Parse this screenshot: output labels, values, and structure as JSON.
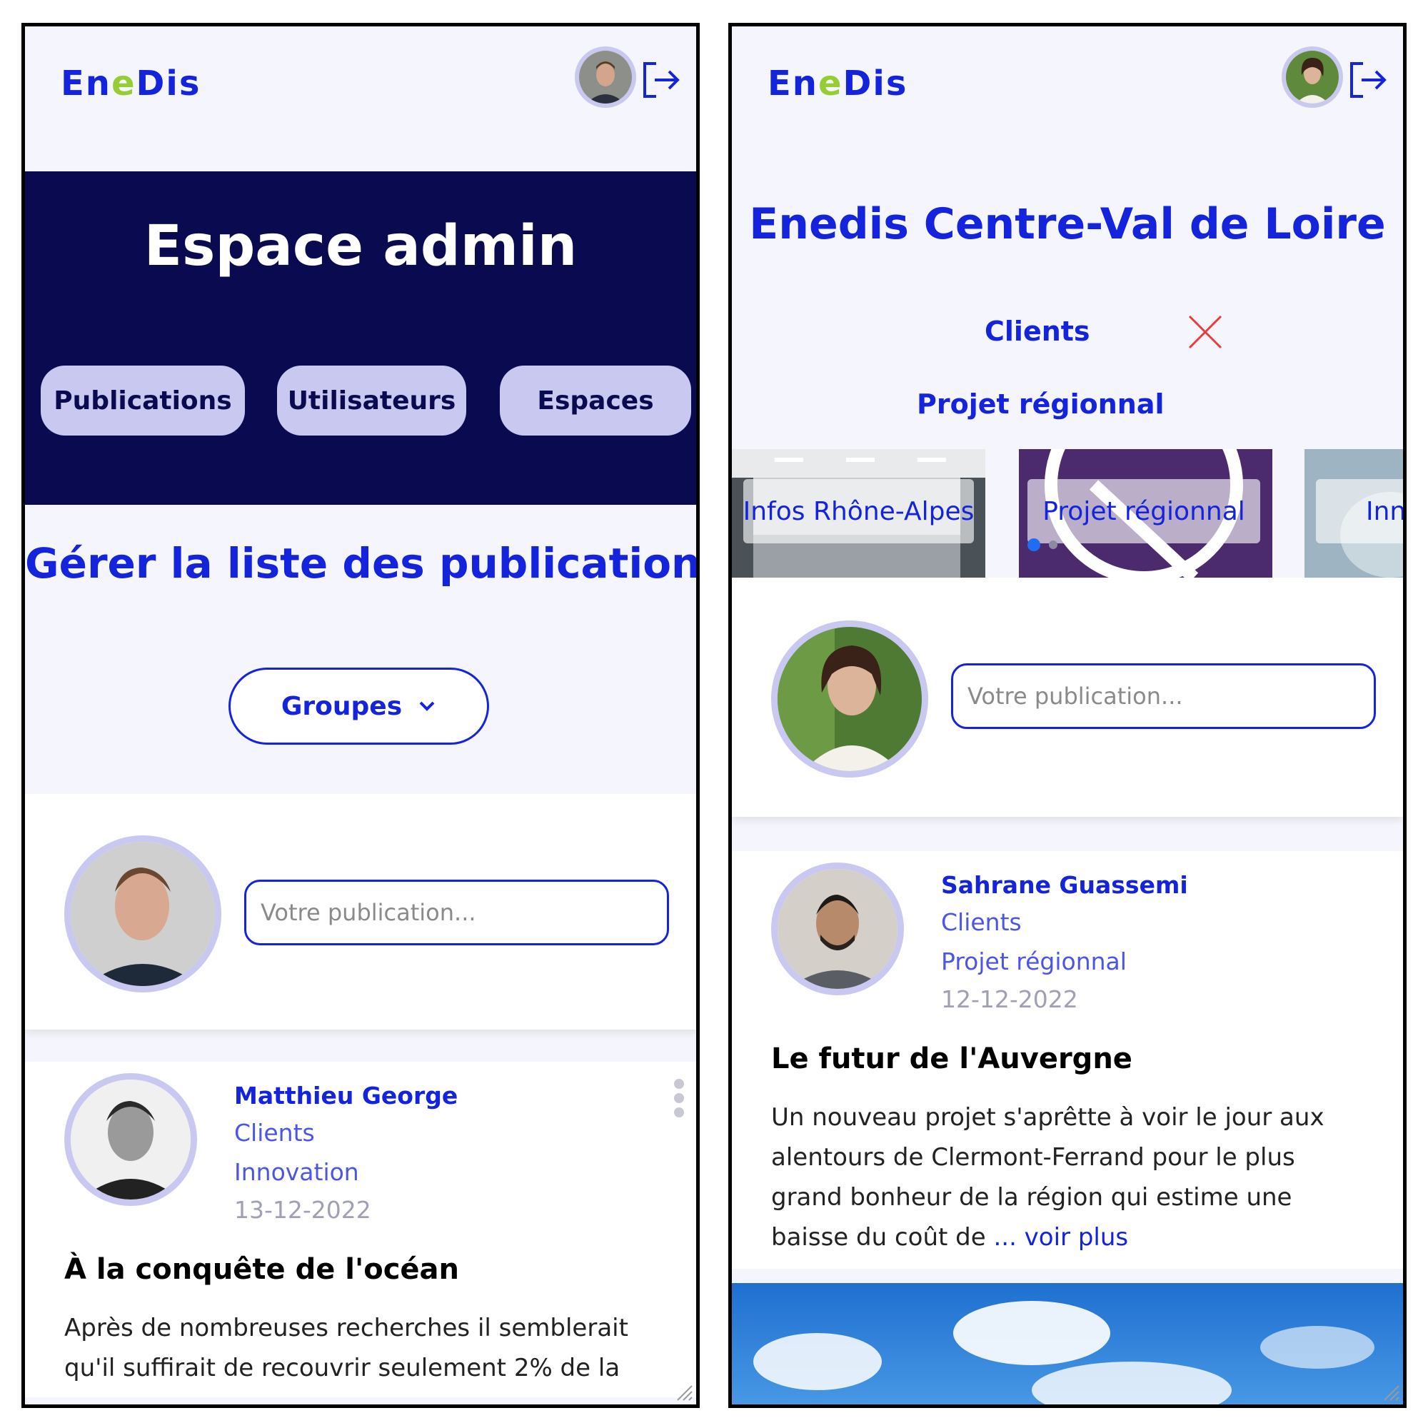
{
  "colors": {
    "brand_blue": "#1423dc",
    "navy": "#0a0a50",
    "lavender": "#c8c8f0",
    "green": "#96cd32",
    "close_red": "#e83c3c"
  },
  "left": {
    "header": {
      "logo_parts": [
        "En",
        "e",
        "Dis"
      ],
      "logout_icon": "logout-icon"
    },
    "banner": {
      "title": "Espace admin",
      "buttons": {
        "publications": "Publications",
        "users": "Utilisateurs",
        "spaces": "Espaces"
      }
    },
    "section_title": "Gérer la liste des publications",
    "group_select": {
      "label": "Groupes",
      "icon": "chevron-down-icon"
    },
    "composer": {
      "placeholder": "Votre publication..."
    },
    "post": {
      "author": "Matthieu  George",
      "category": "Clients",
      "group": "Innovation",
      "date": "13-12-2022",
      "title": "À la conquête de l'océan",
      "body": "Après de nombreuses recherches il semblerait qu'il suffirait de recouvrir seulement 2% de la"
    }
  },
  "right": {
    "header": {
      "logo_parts": [
        "En",
        "e",
        "Dis"
      ],
      "logout_icon": "logout-icon"
    },
    "space_title": "Enedis Centre-Val de Loire",
    "filters": {
      "category": "Clients",
      "close_icon": "close-icon",
      "group": "Projet régionnal"
    },
    "carousel": [
      {
        "label": "Infos Rhône-Alpes"
      },
      {
        "label": "Projet régionnal"
      },
      {
        "label": "Innovation"
      }
    ],
    "composer": {
      "placeholder": "Votre publication..."
    },
    "post": {
      "author": "Sahrane  Guassemi",
      "category": "Clients",
      "group": "Projet régionnal",
      "date": "12-12-2022",
      "title": "Le futur de l'Auvergne",
      "body": "Un nouveau projet s'aprêtte à voir le jour aux alentours de Clermont-Ferrand pour le plus grand bonheur de la région qui estime une baisse du coût de",
      "read_more": "... voir plus"
    }
  }
}
